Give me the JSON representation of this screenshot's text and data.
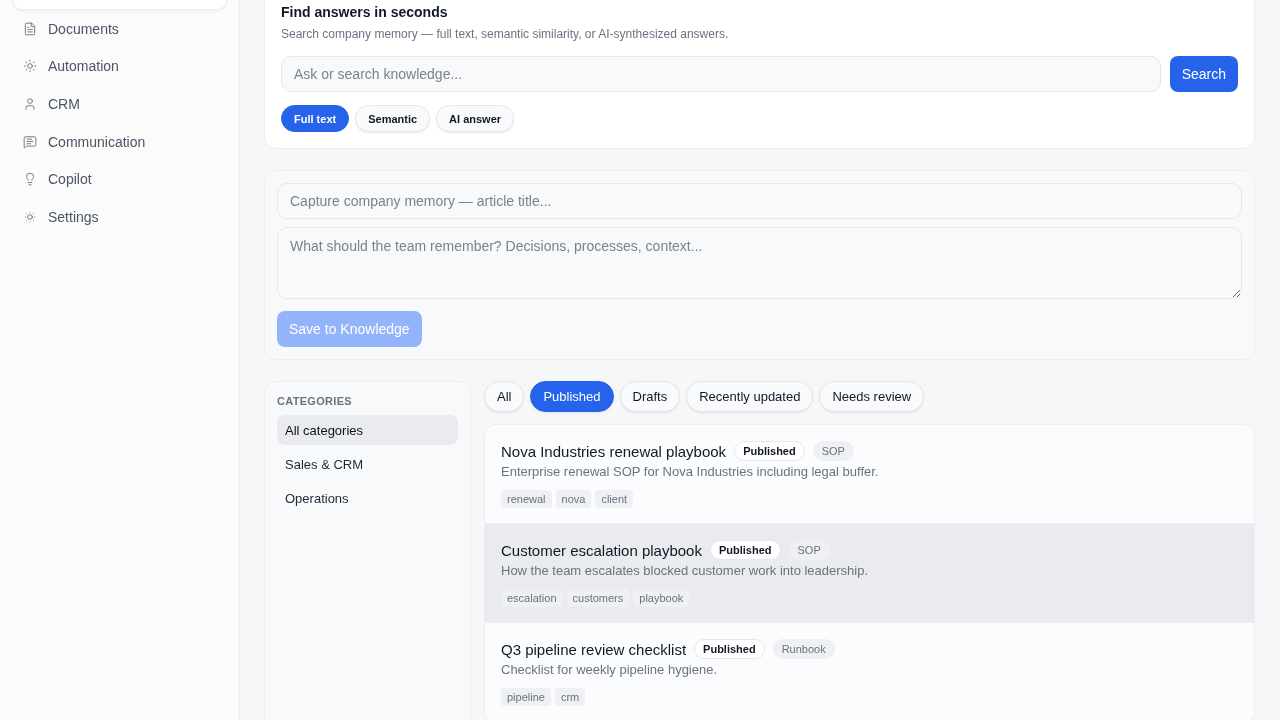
{
  "sidebar": {
    "items": [
      {
        "label": "Documents",
        "selected": false
      },
      {
        "label": "Automation",
        "selected": false
      },
      {
        "label": "CRM",
        "selected": false
      },
      {
        "label": "Communication",
        "selected": false
      },
      {
        "label": "Copilot",
        "selected": false
      },
      {
        "label": "Settings",
        "selected": false
      }
    ]
  },
  "search": {
    "title": "Find answers in seconds",
    "subtitle": "Search company memory — full text, semantic similarity, or AI-synthesized answers.",
    "placeholder": "Ask or search knowledge...",
    "button": "Search",
    "modes": [
      {
        "label": "Full text",
        "selected": true
      },
      {
        "label": "Semantic",
        "selected": false
      },
      {
        "label": "AI answer",
        "selected": false
      }
    ]
  },
  "capture": {
    "title_placeholder": "Capture company memory — article title...",
    "body_placeholder": "What should the team remember? Decisions, processes, context...",
    "button": {
      "label": "Save to Knowledge",
      "disabled": true
    }
  },
  "categories": {
    "heading": "CATEGORIES",
    "items": [
      {
        "label": "All categories",
        "selected": true
      },
      {
        "label": "Sales & CRM",
        "selected": false
      },
      {
        "label": "Operations",
        "selected": false
      }
    ]
  },
  "filters": [
    {
      "label": "All",
      "selected": false
    },
    {
      "label": "Published",
      "selected": true
    },
    {
      "label": "Drafts",
      "selected": false
    },
    {
      "label": "Recently updated",
      "selected": false
    },
    {
      "label": "Needs review",
      "selected": false
    }
  ],
  "articles": [
    {
      "title": "Nova Industries renewal playbook",
      "status": "Published",
      "type": "SOP",
      "description": "Enterprise renewal SOP for Nova Industries including legal buffer.",
      "tags": [
        "renewal",
        "nova",
        "client"
      ],
      "highlighted": false
    },
    {
      "title": "Customer escalation playbook",
      "status": "Published",
      "type": "SOP",
      "description": "How the team escalates blocked customer work into leadership.",
      "tags": [
        "escalation",
        "customers",
        "playbook"
      ],
      "highlighted": true
    },
    {
      "title": "Q3 pipeline review checklist",
      "status": "Published",
      "type": "Runbook",
      "description": "Checklist for weekly pipeline hygiene.",
      "tags": [
        "pipeline",
        "crm"
      ],
      "highlighted": false
    }
  ]
}
